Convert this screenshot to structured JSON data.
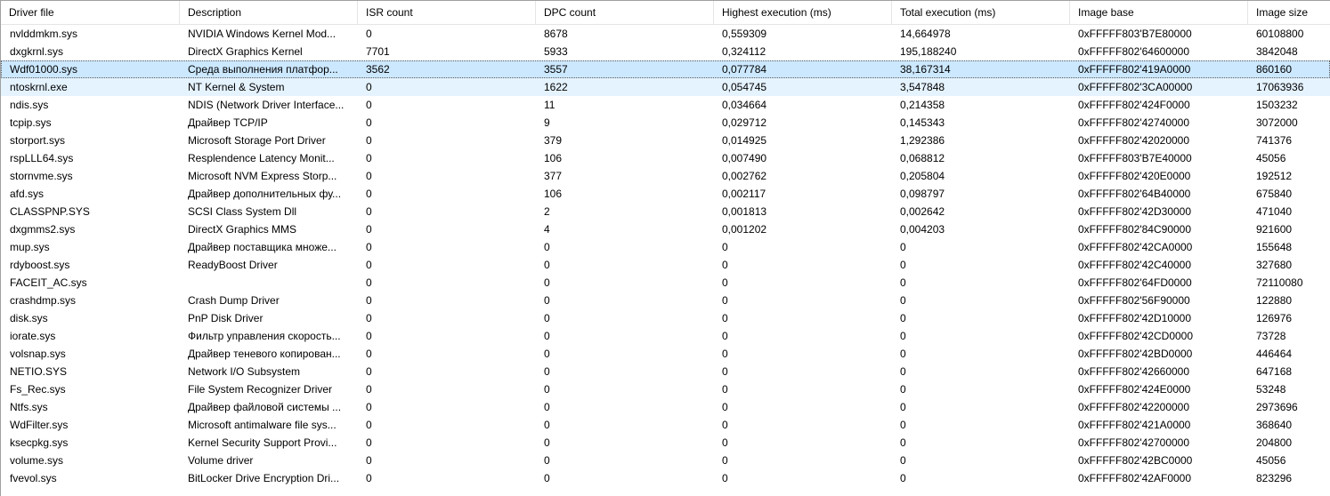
{
  "columns": [
    "Driver file",
    "Description",
    "ISR count",
    "DPC count",
    "Highest execution (ms)",
    "Total execution (ms)",
    "Image base",
    "Image size"
  ],
  "rows": [
    [
      "nvlddmkm.sys",
      "NVIDIA Windows Kernel Mod...",
      "0",
      "8678",
      "0,559309",
      "14,664978",
      "0xFFFFF803'B7E80000",
      "60108800"
    ],
    [
      "dxgkrnl.sys",
      "DirectX Graphics Kernel",
      "7701",
      "5933",
      "0,324112",
      "195,188240",
      "0xFFFFF802'64600000",
      "3842048"
    ],
    [
      "Wdf01000.sys",
      "Среда выполнения платфор...",
      "3562",
      "3557",
      "0,077784",
      "38,167314",
      "0xFFFFF802'419A0000",
      "860160"
    ],
    [
      "ntoskrnl.exe",
      "NT Kernel & System",
      "0",
      "1622",
      "0,054745",
      "3,547848",
      "0xFFFFF802'3CA00000",
      "17063936"
    ],
    [
      "ndis.sys",
      "NDIS (Network Driver Interface...",
      "0",
      "11",
      "0,034664",
      "0,214358",
      "0xFFFFF802'424F0000",
      "1503232"
    ],
    [
      "tcpip.sys",
      "Драйвер TCP/IP",
      "0",
      "9",
      "0,029712",
      "0,145343",
      "0xFFFFF802'42740000",
      "3072000"
    ],
    [
      "storport.sys",
      "Microsoft Storage Port Driver",
      "0",
      "379",
      "0,014925",
      "1,292386",
      "0xFFFFF802'42020000",
      "741376"
    ],
    [
      "rspLLL64.sys",
      "Resplendence Latency Monit...",
      "0",
      "106",
      "0,007490",
      "0,068812",
      "0xFFFFF803'B7E40000",
      "45056"
    ],
    [
      "stornvme.sys",
      "Microsoft NVM Express Storp...",
      "0",
      "377",
      "0,002762",
      "0,205804",
      "0xFFFFF802'420E0000",
      "192512"
    ],
    [
      "afd.sys",
      "Драйвер дополнительных фу...",
      "0",
      "106",
      "0,002117",
      "0,098797",
      "0xFFFFF802'64B40000",
      "675840"
    ],
    [
      "CLASSPNP.SYS",
      "SCSI Class System Dll",
      "0",
      "2",
      "0,001813",
      "0,002642",
      "0xFFFFF802'42D30000",
      "471040"
    ],
    [
      "dxgmms2.sys",
      "DirectX Graphics MMS",
      "0",
      "4",
      "0,001202",
      "0,004203",
      "0xFFFFF802'84C90000",
      "921600"
    ],
    [
      "mup.sys",
      "Драйвер поставщика множе...",
      "0",
      "0",
      "0",
      "0",
      "0xFFFFF802'42CA0000",
      "155648"
    ],
    [
      "rdyboost.sys",
      "ReadyBoost Driver",
      "0",
      "0",
      "0",
      "0",
      "0xFFFFF802'42C40000",
      "327680"
    ],
    [
      "FACEIT_AC.sys",
      "",
      "0",
      "0",
      "0",
      "0",
      "0xFFFFF802'64FD0000",
      "72110080"
    ],
    [
      "crashdmp.sys",
      "Crash Dump Driver",
      "0",
      "0",
      "0",
      "0",
      "0xFFFFF802'56F90000",
      "122880"
    ],
    [
      "disk.sys",
      "PnP Disk Driver",
      "0",
      "0",
      "0",
      "0",
      "0xFFFFF802'42D10000",
      "126976"
    ],
    [
      "iorate.sys",
      "Фильтр управления скорость...",
      "0",
      "0",
      "0",
      "0",
      "0xFFFFF802'42CD0000",
      "73728"
    ],
    [
      "volsnap.sys",
      "Драйвер теневого копирован...",
      "0",
      "0",
      "0",
      "0",
      "0xFFFFF802'42BD0000",
      "446464"
    ],
    [
      "NETIO.SYS",
      "Network I/O Subsystem",
      "0",
      "0",
      "0",
      "0",
      "0xFFFFF802'42660000",
      "647168"
    ],
    [
      "Fs_Rec.sys",
      "File System Recognizer Driver",
      "0",
      "0",
      "0",
      "0",
      "0xFFFFF802'424E0000",
      "53248"
    ],
    [
      "Ntfs.sys",
      "Драйвер файловой системы ...",
      "0",
      "0",
      "0",
      "0",
      "0xFFFFF802'42200000",
      "2973696"
    ],
    [
      "WdFilter.sys",
      "Microsoft antimalware file sys...",
      "0",
      "0",
      "0",
      "0",
      "0xFFFFF802'421A0000",
      "368640"
    ],
    [
      "ksecpkg.sys",
      "Kernel Security Support Provi...",
      "0",
      "0",
      "0",
      "0",
      "0xFFFFF802'42700000",
      "204800"
    ],
    [
      "volume.sys",
      "Volume driver",
      "0",
      "0",
      "0",
      "0",
      "0xFFFFF802'42BC0000",
      "45056"
    ],
    [
      "fvevol.sys",
      "BitLocker Drive Encryption Dri...",
      "0",
      "0",
      "0",
      "0",
      "0xFFFFF802'42AF0000",
      "823296"
    ]
  ],
  "selected_row": 2,
  "hover_row": 3
}
